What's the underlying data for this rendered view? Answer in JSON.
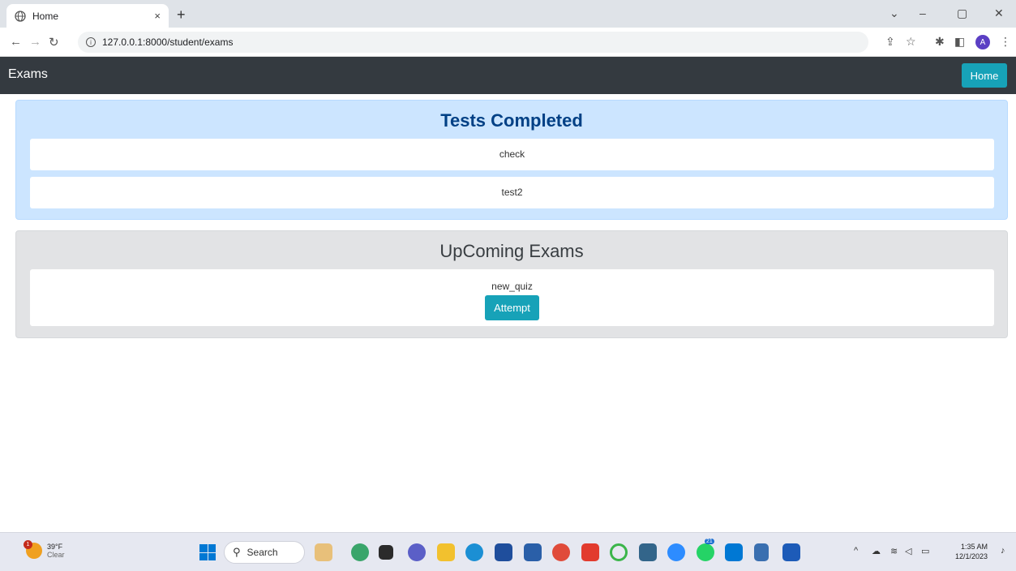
{
  "browser": {
    "tab_title": "Home",
    "tab_close": "×",
    "new_tab": "+",
    "url": "127.0.0.1:8000/student/exams",
    "avatar_letter": "A",
    "window_controls": [
      "⌄",
      "–",
      "▢",
      "✕"
    ]
  },
  "navbar": {
    "brand": "Exams",
    "home_label": "Home"
  },
  "completed": {
    "title": "Tests Completed",
    "items": [
      {
        "name": "check"
      },
      {
        "name": "test2"
      }
    ]
  },
  "upcoming": {
    "title": "UpComing Exams",
    "items": [
      {
        "name": "new_quiz",
        "action_label": "Attempt"
      }
    ]
  },
  "taskbar": {
    "weather_temp": "39°F",
    "weather_desc": "Clear",
    "weather_badge": "1",
    "search_label": "Search",
    "time": "1:35 AM",
    "date": "12/1/2023",
    "app_badge": "21",
    "app_icons": [
      "paint-icon",
      "copilot-icon",
      "task-view-icon",
      "chat-icon",
      "file-explorer-icon",
      "edge-icon",
      "store-icon",
      "app-icon",
      "chrome-icon",
      "app-icon",
      "app-icon",
      "pgadmin-icon",
      "zoom-icon",
      "whatsapp-icon",
      "vscode-icon",
      "notepad-icon",
      "word-icon"
    ]
  },
  "colors": {
    "navbar_bg": "#343a40",
    "info_btn": "#17a2b8",
    "completed_bg": "#cce5ff",
    "upcoming_bg": "#e2e3e5"
  }
}
